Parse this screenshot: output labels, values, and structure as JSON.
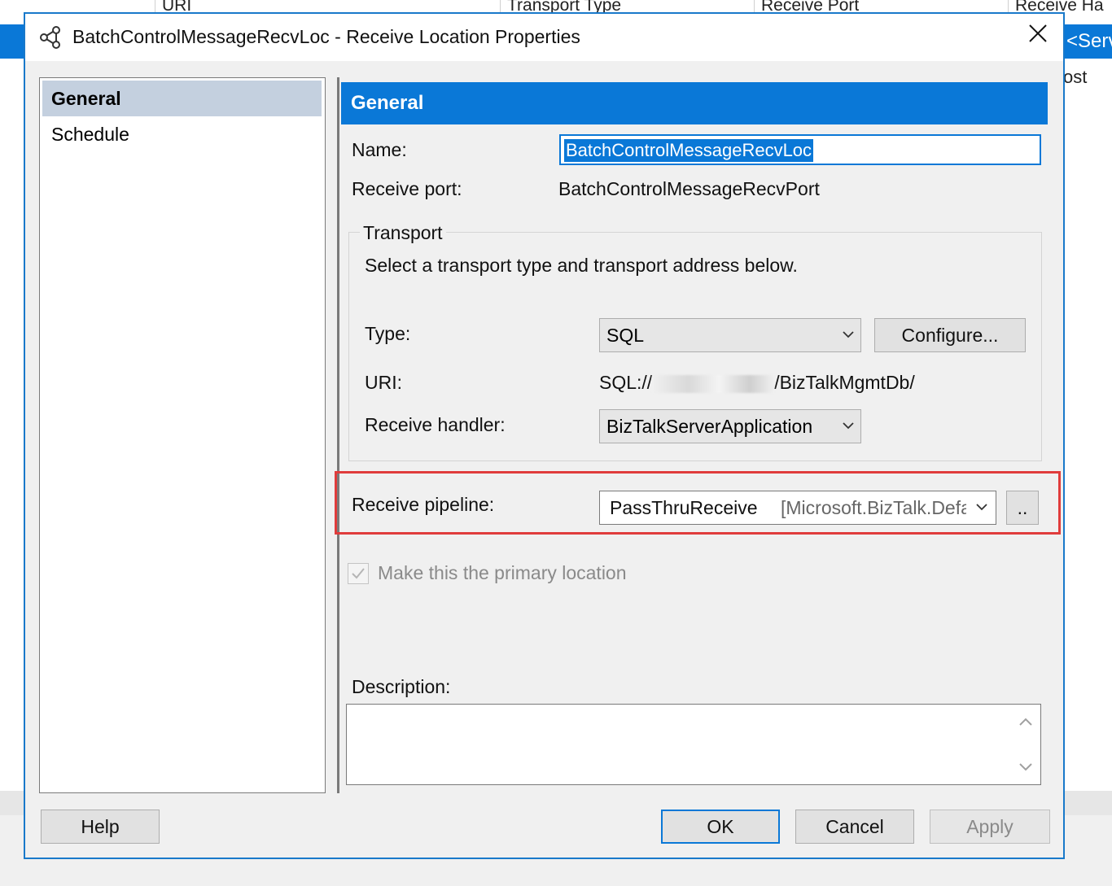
{
  "background": {
    "columns": [
      "URI",
      "Transport Type",
      "Receive Port",
      "Receive Ha"
    ],
    "selected_row_right_text": "<Serve",
    "right_text_2": "ost"
  },
  "dialog": {
    "title": "BatchControlMessageRecvLoc - Receive Location Properties",
    "close_glyph": "✕"
  },
  "nav": {
    "items": [
      {
        "label": "General",
        "selected": true
      },
      {
        "label": "Schedule",
        "selected": false
      }
    ]
  },
  "general": {
    "header": "General",
    "name_label": "Name:",
    "name_value": "BatchControlMessageRecvLoc",
    "receive_port_label": "Receive port:",
    "receive_port_value": "BatchControlMessageRecvPort",
    "transport": {
      "legend": "Transport",
      "instructions": "Select a transport type and transport address below.",
      "type_label": "Type:",
      "type_value": "SQL",
      "configure_label": "Configure...",
      "uri_label": "URI:",
      "uri_prefix": "SQL://",
      "uri_suffix": "/BizTalkMgmtDb/",
      "handler_label": "Receive handler:",
      "handler_value": "BizTalkServerApplication"
    },
    "pipeline": {
      "label": "Receive pipeline:",
      "name": "PassThruReceive",
      "assembly": "[Microsoft.BizTalk.Defau",
      "browse_label": ".."
    },
    "primary_location": {
      "label": "Make this the primary location",
      "checked": true,
      "enabled": false
    },
    "description_label": "Description:",
    "description_value": ""
  },
  "buttons": {
    "help": "Help",
    "ok": "OK",
    "cancel": "Cancel",
    "apply": "Apply"
  },
  "colors": {
    "accent": "#0a78d7",
    "highlight_border": "#e03c3c",
    "dialog_bg": "#f0f0f0"
  }
}
